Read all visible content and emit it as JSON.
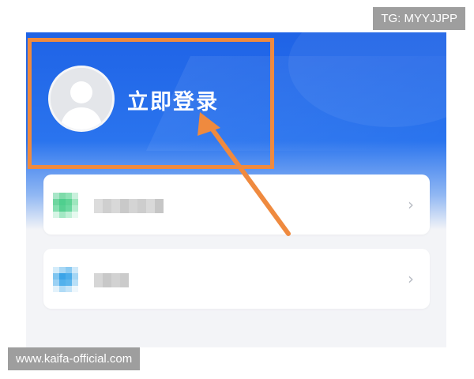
{
  "profile": {
    "login_label": "立即登录",
    "avatar_icon": "user-avatar-icon"
  },
  "menu": {
    "items": [
      {
        "label_text": "",
        "icon": "blurred-app-icon",
        "chevron": "›"
      },
      {
        "label_text": "",
        "icon": "blurred-app-icon",
        "chevron": "›"
      }
    ]
  },
  "watermarks": {
    "top": "TG: MYYJJPP",
    "bottom": "www.kaifa-official.com"
  },
  "colors": {
    "header_blue": "#1f63e6",
    "annotation_orange": "#ef8a3f"
  }
}
